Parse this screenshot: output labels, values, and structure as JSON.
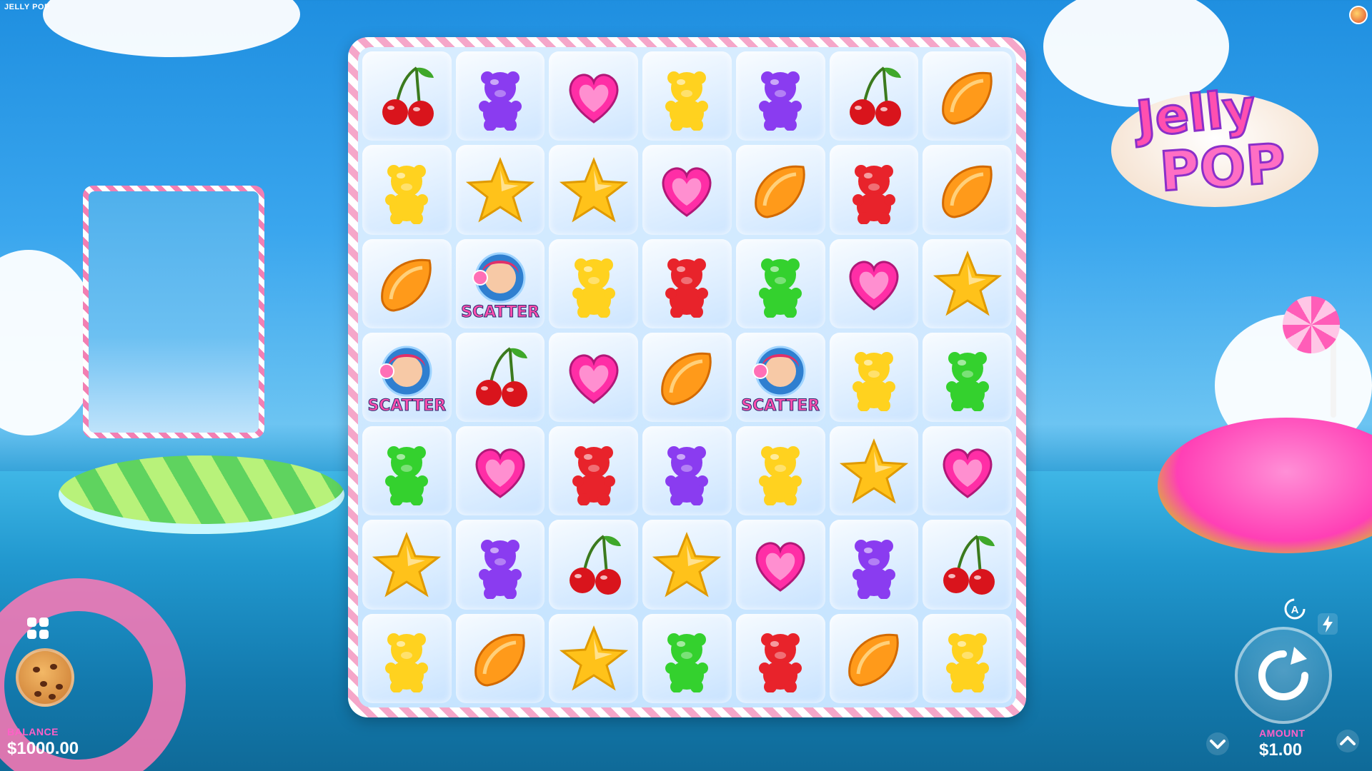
{
  "app": {
    "title": "JELLY POP"
  },
  "logo": {
    "line1": "Jelly",
    "line2": "POP"
  },
  "grid": {
    "rows": [
      [
        "cherry",
        "bear-purple",
        "heart",
        "bear-yellow",
        "bear-purple",
        "cherry",
        "orange-slice"
      ],
      [
        "bear-yellow",
        "star",
        "star",
        "heart",
        "orange-slice",
        "bear-red",
        "orange-slice"
      ],
      [
        "orange-slice",
        "scatter",
        "bear-yellow",
        "bear-red",
        "bear-green",
        "heart",
        "star"
      ],
      [
        "scatter",
        "cherry",
        "heart",
        "orange-slice",
        "scatter",
        "bear-yellow",
        "bear-green"
      ],
      [
        "bear-green",
        "heart",
        "bear-red",
        "bear-purple",
        "bear-yellow",
        "star",
        "heart"
      ],
      [
        "star",
        "bear-purple",
        "cherry",
        "star",
        "heart",
        "bear-purple",
        "cherry"
      ],
      [
        "bear-yellow",
        "orange-slice",
        "star",
        "bear-green",
        "bear-red",
        "orange-slice",
        "bear-yellow"
      ]
    ],
    "scatter_label": "SCATTER"
  },
  "balance": {
    "label": "BALANCE",
    "value": "$1000.00"
  },
  "bet": {
    "label": "AMOUNT",
    "value": "$1.00"
  },
  "colors": {
    "bear-purple": "#8a3cf0",
    "bear-yellow": "#ffd21f",
    "bear-red": "#e8232b",
    "bear-green": "#34d12e",
    "heart": "#ff2ea6",
    "star": "#ffc21a",
    "orange-slice": "#ff9a1a",
    "cherry": "#d9141c"
  },
  "icons": {
    "menu": "grid-icon",
    "cookie": "cookie-icon",
    "spin": "refresh-icon",
    "autoplay": "autoplay-icon",
    "turbo": "lightning-icon",
    "bet_down": "chevron-down-icon",
    "bet_up": "chevron-up-icon"
  }
}
